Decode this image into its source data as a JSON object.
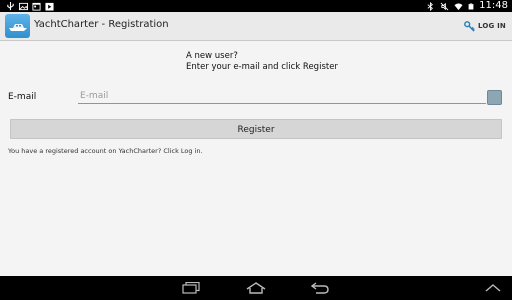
{
  "status_bar": {
    "time": "11:48",
    "icons": [
      "usb-icon",
      "image-icon",
      "calendar-icon",
      "play-store-icon",
      "bluetooth-icon",
      "mute-icon",
      "wifi-icon",
      "battery-icon"
    ]
  },
  "action_bar": {
    "title": "YachtCharter - Registration",
    "login_label": "LOG IN"
  },
  "form": {
    "intro_line1": "A new user?",
    "intro_line2": "Enter your e-mail and click Register",
    "email_label": "E-mail",
    "email_placeholder": "E-mail",
    "email_value": "",
    "register_label": "Register",
    "info_text": "You have a registered account on YachCharter? Click Log in."
  },
  "nav_bar": {
    "buttons": [
      "recent-apps",
      "home",
      "back",
      "collapse"
    ]
  },
  "colors": {
    "accent": "#33b5e5",
    "status_bar_bg": "#000000",
    "action_bar_bg": "#eaeaea",
    "button_bg": "#d6d6d6"
  }
}
